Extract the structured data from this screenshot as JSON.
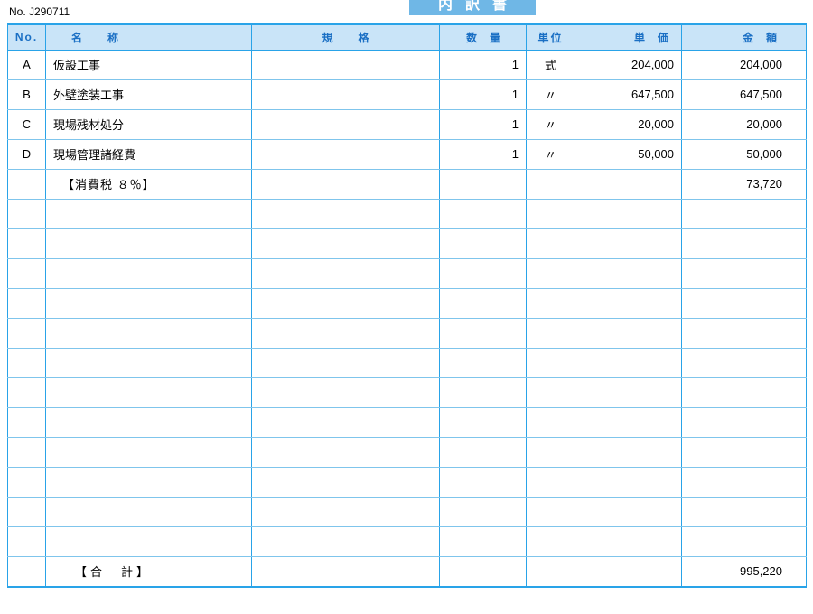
{
  "doc_number_label": "No. J290711",
  "title": "内訳書",
  "headers": {
    "no": "No.",
    "name": "名称",
    "spec": "規格",
    "qty": "数量",
    "unit": "単位",
    "unit_price": "単価",
    "amount": "金額"
  },
  "rows": [
    {
      "no": "A",
      "name": "仮設工事",
      "spec": "",
      "qty": "1",
      "unit": "式",
      "unit_price": "204,000",
      "amount": "204,000"
    },
    {
      "no": "B",
      "name": "外壁塗装工事",
      "spec": "",
      "qty": "1",
      "unit": "〃",
      "unit_price": "647,500",
      "amount": "647,500"
    },
    {
      "no": "C",
      "name": "現場残材処分",
      "spec": "",
      "qty": "1",
      "unit": "〃",
      "unit_price": "20,000",
      "amount": "20,000"
    },
    {
      "no": "D",
      "name": "現場管理諸経費",
      "spec": "",
      "qty": "1",
      "unit": "〃",
      "unit_price": "50,000",
      "amount": "50,000"
    }
  ],
  "tax_row": {
    "label": "【消費税  ８％】",
    "amount": "73,720"
  },
  "empty_row_count": 12,
  "total_row": {
    "label": "【合　計】",
    "amount": "995,220"
  },
  "chart_data": {
    "type": "table",
    "title": "内訳書",
    "doc_number": "J290711",
    "columns": [
      "No.",
      "名称",
      "規格",
      "数量",
      "単位",
      "単価",
      "金額"
    ],
    "items": [
      {
        "No.": "A",
        "名称": "仮設工事",
        "規格": "",
        "数量": 1,
        "単位": "式",
        "単価": 204000,
        "金額": 204000
      },
      {
        "No.": "B",
        "名称": "外壁塗装工事",
        "規格": "",
        "数量": 1,
        "単位": "式",
        "単価": 647500,
        "金額": 647500
      },
      {
        "No.": "C",
        "名称": "現場残材処分",
        "規格": "",
        "数量": 1,
        "単位": "式",
        "単価": 20000,
        "金額": 20000
      },
      {
        "No.": "D",
        "名称": "現場管理諸経費",
        "規格": "",
        "数量": 1,
        "単位": "式",
        "単価": 50000,
        "金額": 50000
      }
    ],
    "tax": {
      "label": "消費税 8%",
      "amount": 73720
    },
    "total": 995220
  }
}
